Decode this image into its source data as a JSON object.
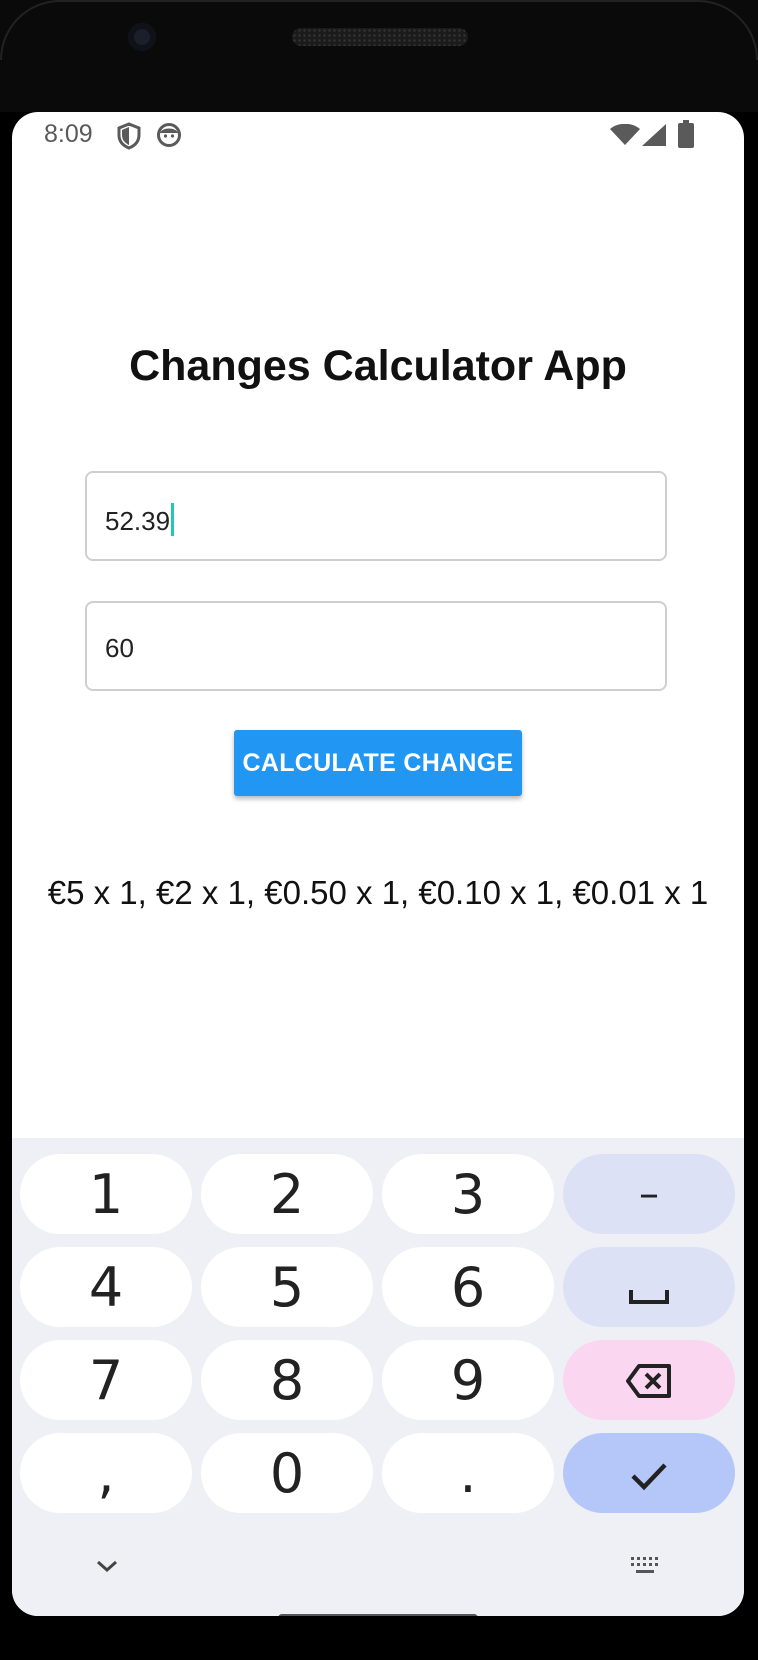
{
  "status_bar": {
    "time": "8:09",
    "icons": [
      "shield-icon",
      "face-icon",
      "wifi-icon",
      "signal-icon",
      "battery-icon"
    ]
  },
  "app": {
    "title": "Changes Calculator App",
    "price_input_value": "52.39",
    "paid_input_value": "60",
    "calculate_button_label": "CALCULATE CHANGE",
    "result_text": "€5 x 1, €2 x 1, €0.50 x 1, €0.10 x 1, €0.01 x 1",
    "accent_color": "#2196f3"
  },
  "keyboard": {
    "row1": [
      "1",
      "2",
      "3",
      "–"
    ],
    "row2": [
      "4",
      "5",
      "6"
    ],
    "row3": [
      "7",
      "8",
      "9"
    ],
    "row4": [
      ",",
      "0",
      "."
    ],
    "icons": [
      "space-icon",
      "backspace-icon",
      "check-icon",
      "chevron-down-icon",
      "keyboard-icon"
    ]
  }
}
